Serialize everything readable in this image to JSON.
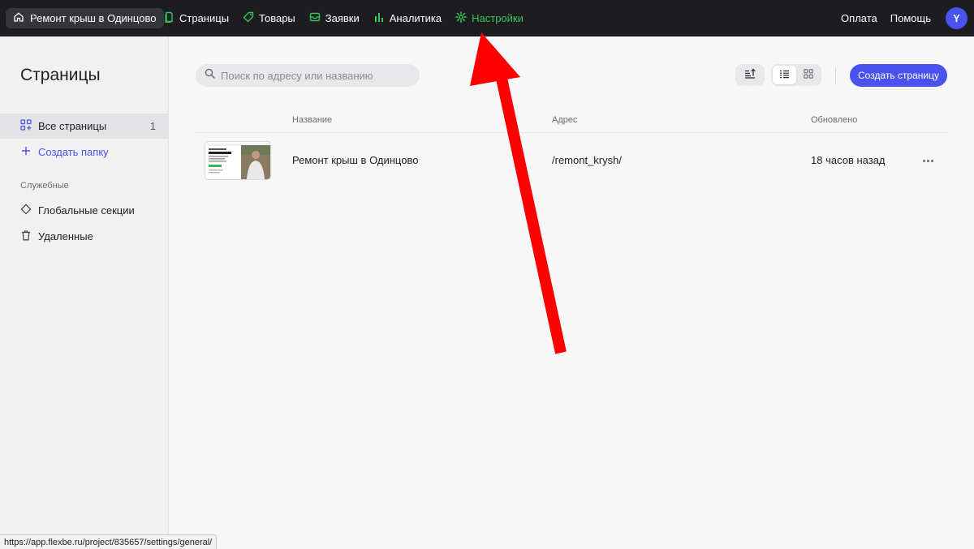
{
  "topbar": {
    "project_name": "Ремонт крыш в Одинцово",
    "nav": [
      {
        "label": "Страницы",
        "icon": "page-icon"
      },
      {
        "label": "Товары",
        "icon": "tag-icon"
      },
      {
        "label": "Заявки",
        "icon": "inbox-icon"
      },
      {
        "label": "Аналитика",
        "icon": "bar-chart-icon"
      },
      {
        "label": "Настройки",
        "icon": "gear-icon",
        "active": true
      }
    ],
    "payment": "Оплата",
    "help": "Помощь",
    "avatar_letter": "Y"
  },
  "sidebar": {
    "title": "Страницы",
    "all_pages": {
      "label": "Все страницы",
      "count": "1"
    },
    "create_folder": "Создать папку",
    "section_label": "Служебные",
    "global_sections": "Глобальные секции",
    "deleted": "Удаленные"
  },
  "main": {
    "search_placeholder": "Поиск по адресу или названию",
    "create_button": "Создать страницу",
    "columns": {
      "name": "Название",
      "address": "Адрес",
      "updated": "Обновлено"
    },
    "rows": [
      {
        "name": "Ремонт крыш в Одинцово",
        "address": "/remont_krysh/",
        "updated": "18 часов назад"
      }
    ]
  },
  "statusbar": {
    "url": "https://app.flexbe.ru/project/835657/settings/general/"
  },
  "colors": {
    "accent": "#4a52f0",
    "active_nav": "#35c759",
    "topbar": "#1c1c21",
    "arrow": "#ff0000"
  }
}
